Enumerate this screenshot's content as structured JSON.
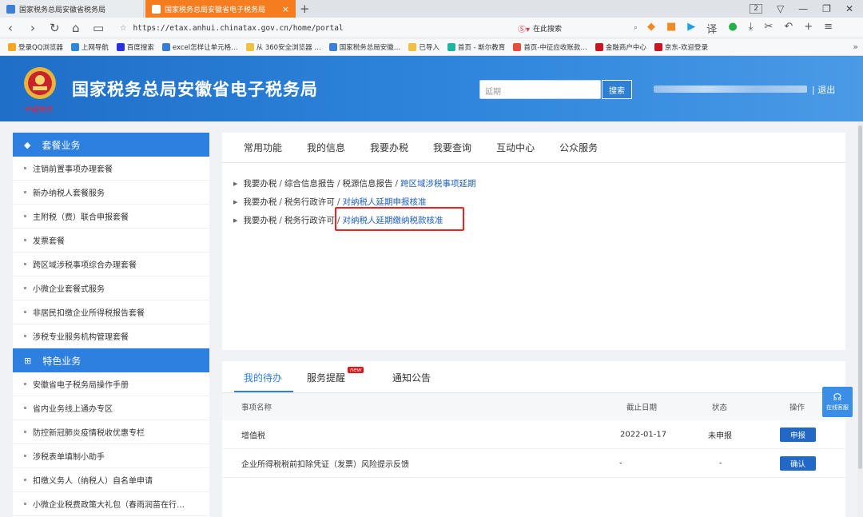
{
  "browser": {
    "tabs": [
      {
        "label": "国家税务总局安徽省税务局"
      },
      {
        "label": "国家税务总局安徽省电子税务局"
      }
    ],
    "window_count": "2",
    "url": "https://etax.anhui.chinatax.gov.cn/home/portal",
    "search_placeholder": "在此搜索",
    "bookmarks": [
      {
        "label": "登录QQ浏览器",
        "color": "#f5a623"
      },
      {
        "label": "上网导航",
        "color": "#2f86dc"
      },
      {
        "label": "百度搜索",
        "color": "#2932e1"
      },
      {
        "label": "excel怎样让单元格…",
        "color": "#3a7bd5"
      },
      {
        "label": "从 360安全浏览器 …",
        "color": "#f0c040"
      },
      {
        "label": "国家税务总局安徽…",
        "color": "#3d7fd6"
      },
      {
        "label": "已导入",
        "color": "#f0c040"
      },
      {
        "label": "首页 - 斯尔教育",
        "color": "#1fb5a5"
      },
      {
        "label": "首页-中征应收账款…",
        "color": "#e84c3d"
      },
      {
        "label": "金融商户中心",
        "color": "#c81623"
      },
      {
        "label": "京东-欢迎登录",
        "color": "#c81623"
      }
    ]
  },
  "header": {
    "title": "国家税务总局安徽省电子税务局",
    "emblem_text": "中国税务",
    "search_placeholder": "延期",
    "search_button": "搜索",
    "logout": "| 退出"
  },
  "sidebar": {
    "sections": [
      {
        "title": "套餐业务",
        "items": [
          "注销前置事项办理套餐",
          "新办纳税人套餐服务",
          "主附税（费）联合申报套餐",
          "发票套餐",
          "跨区域涉税事项综合办理套餐",
          "小微企业套餐式服务",
          "非居民扣缴企业所得税报告套餐",
          "涉税专业服务机构管理套餐"
        ]
      },
      {
        "title": "特色业务",
        "items": [
          "安徽省电子税务局操作手册",
          "省内业务线上通办专区",
          "防控新冠肺炎疫情税收优惠专栏",
          "涉税表单填制小助手",
          "扣缴义务人（纳税人）自名单申请",
          "小微企业税费政策大礼包（春雨润苗在行…"
        ]
      }
    ]
  },
  "main_tabs": [
    "常用功能",
    "我的信息",
    "我要办税",
    "我要查询",
    "互动中心",
    "公众服务"
  ],
  "breadcrumbs": [
    {
      "parts": [
        "我要办税",
        "综合信息报告",
        "税源信息报告"
      ],
      "link": "跨区域涉税事项延期"
    },
    {
      "parts": [
        "我要办税",
        "税务行政许可"
      ],
      "link": "对纳税人延期申报核准"
    },
    {
      "parts": [
        "我要办税",
        "税务行政许可"
      ],
      "link": "对纳税人延期缴纳税款核准"
    }
  ],
  "todo": {
    "tabs": [
      "我的待办",
      "服务提醒",
      "通知公告"
    ],
    "new_badge": "new",
    "columns": [
      "事项名称",
      "截止日期",
      "状态",
      "操作"
    ],
    "rows": [
      {
        "name": "增值税",
        "deadline": "2022-01-17",
        "status": "未申报",
        "action": "申报"
      },
      {
        "name": "企业所得税税前扣除凭证（发票）风险提示反馈",
        "deadline": "-",
        "status": "-",
        "action": "确认"
      }
    ]
  },
  "service_widget": "在线客服"
}
